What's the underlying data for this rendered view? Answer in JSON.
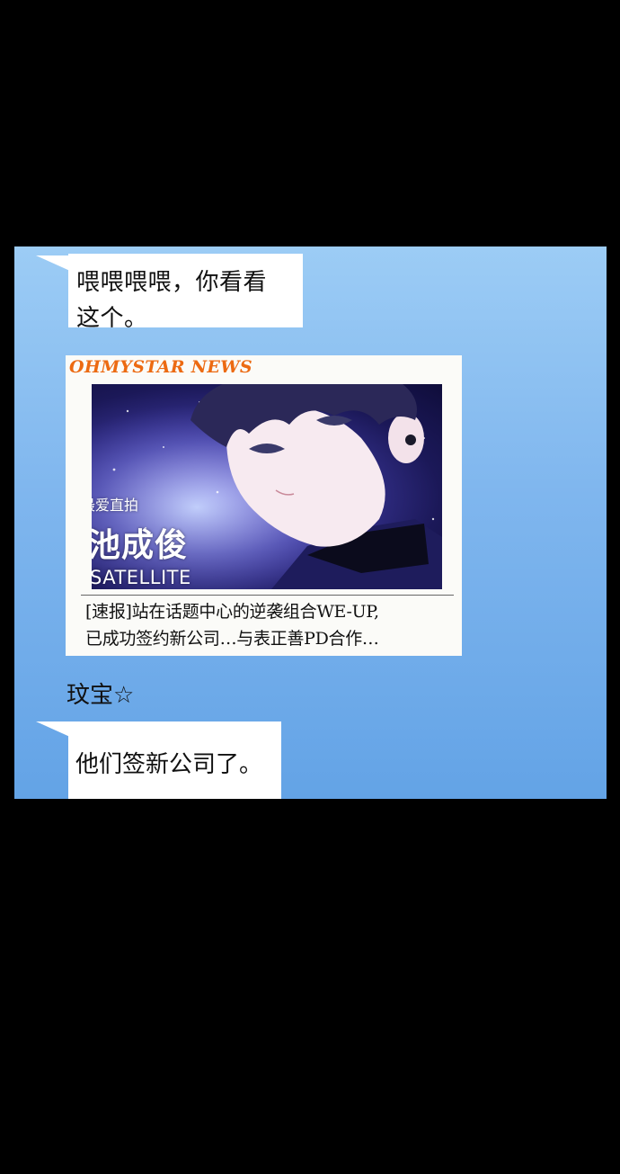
{
  "chat": {
    "message1": "喂喂喂喂，你看看\n这个。",
    "news_card": {
      "brand": "OHMYSTAR NEWS",
      "overlay_tag": "最爱直拍",
      "overlay_name": "池成俊",
      "overlay_group": "SATELLITE",
      "headline": "[速报]站在话题中心的逆袭组合WE-UP,\n已成功签约新公司…与表正善PD合作…"
    },
    "sender_name": "玟宝☆",
    "message2": "他们签新公司了。"
  },
  "colors": {
    "background": "#000000",
    "chat_panel_top": "#9cccf5",
    "chat_panel_bottom": "#63a3e6",
    "bubble": "#ffffff",
    "brand": "#ec6a12"
  }
}
